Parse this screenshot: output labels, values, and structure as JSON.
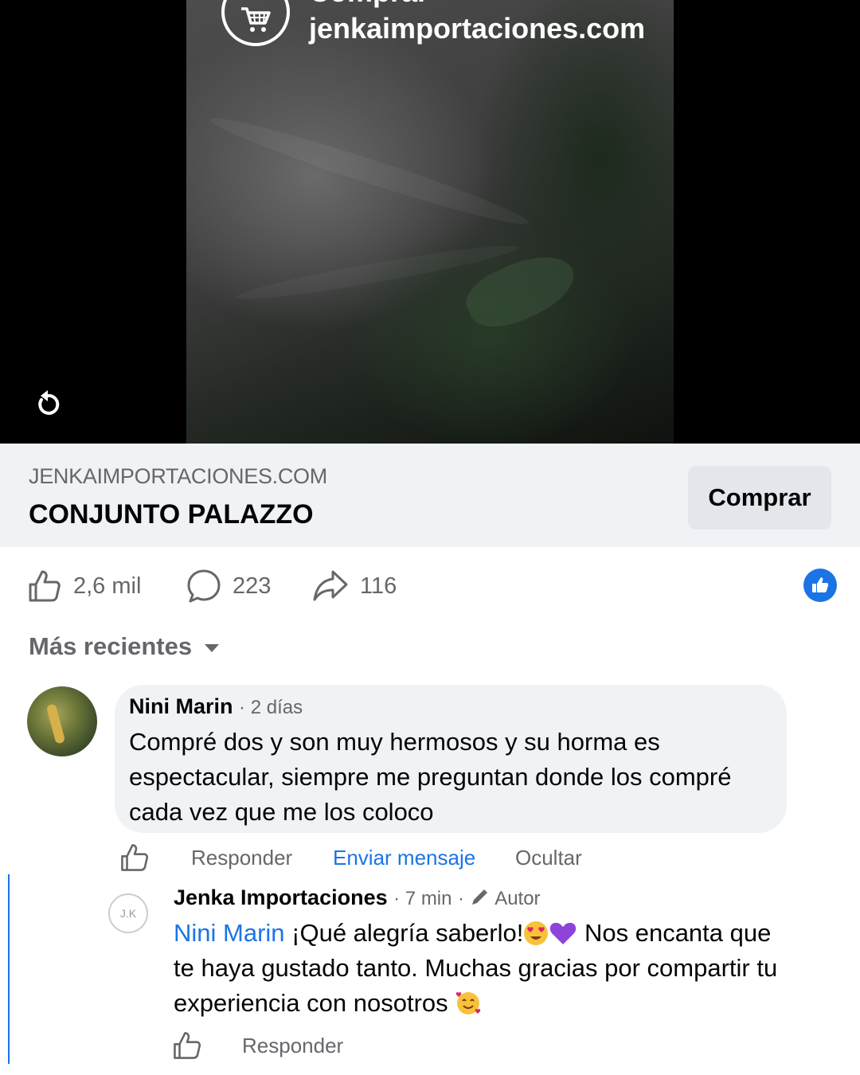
{
  "video": {
    "overlay_top_text": "Comprar",
    "overlay_url": "jenkaimportaciones.com",
    "icons": [
      "cart-icon",
      "replay-icon"
    ]
  },
  "product": {
    "domain": "JENKAIMPORTACIONES.COM",
    "title": "CONJUNTO PALAZZO",
    "buy_label": "Comprar"
  },
  "stats": {
    "likes": "2,6 mil",
    "comments": "223",
    "shares": "116"
  },
  "sort": {
    "label": "Más recientes"
  },
  "comment": {
    "author": "Nini Marin",
    "time": "2 días",
    "text": "Compré dos y son muy hermosos y su horma es espectacular, siempre me preguntan donde los compré cada vez que me los coloco",
    "actions": {
      "reply": "Responder",
      "message": "Enviar mensaje",
      "hide": "Ocultar"
    }
  },
  "reply": {
    "author": "Jenka Importaciones",
    "time": "7 min",
    "badge": "Autor",
    "avatar_text": "J.K",
    "mention": "Nini Marin",
    "text_1": " ¡Qué alegría saberlo!",
    "text_2": " Nos encanta que te haya gustado tanto. Muchas gracias por compartir tu experiencia con nosotros ",
    "actions": {
      "reply": "Responder"
    }
  },
  "colors": {
    "accent": "#1b74e4",
    "muted_text": "#65676b",
    "bubble_bg": "#f0f2f5",
    "button_bg": "#e4e6eb"
  }
}
